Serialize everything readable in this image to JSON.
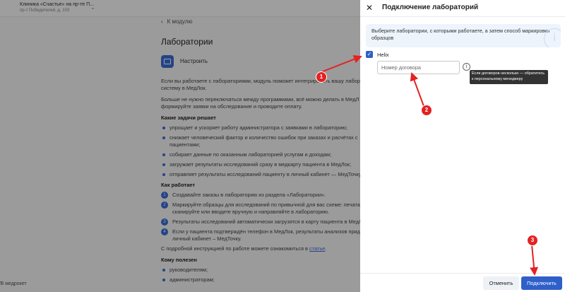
{
  "background": {
    "clinic_name": "Клиника «Счастье» на пр-те П...",
    "clinic_address": "пр-т Победителей, д. 103",
    "back_link": "К модулю",
    "page_title": "Лаборатории",
    "setup_label": "Настроить",
    "intro_1": "Если вы работаете с лабораториями, модуль поможет интегрировать вашу лабор систему в МедЛок.",
    "intro_2": "Больше не нужно переключаться между программами, всё можно делать в МедЛ формируйте заявки на обследование и проводите оплату.",
    "tasks_heading": "Какие задачи решает",
    "tasks": [
      "упрощает и ускоряет работу администратора с заявками в лабораторию;",
      "снижает человеческий фактор и количество ошибок при заказах и расчётах с пациентами;",
      "собирает данные по оказанным лабораторией услугам и доходам;",
      "загружает результаты исследований сразу в медкарту пациента в МедЛок;",
      "отправляет результаты исследований пациенту в личный кабинет — МедТочку."
    ],
    "how_heading": "Как работает",
    "steps": [
      "Создавайте заказы в лабораторию из раздела «Лаборатории».",
      "Маркируйте образцы для исследований по привычной для вас схеме: печата сканируйте или вводите вручную и направляйте в лабораторию.",
      "Результаты исследований автоматически загрузятся в карту пациента в МедЛ",
      "Если у пациента подтверждён телефон в МедЛок, результаты анализов прид в личный кабинет – МедТочку."
    ],
    "instruction_text": "С подробной инструкцией по работе можете ознакомиться в",
    "instruction_link": "статье",
    "useful_heading": "Кому полезен",
    "useful": [
      "руководителям;",
      "администраторам;"
    ],
    "footer_logo": "медрокет"
  },
  "panel": {
    "title": "Подключение лабораторий",
    "info_text": "Выберите лаборатории, с которыми работаете, а затем способ маркировки образцов",
    "lab_name": "Helix",
    "lab_checked": true,
    "contract_placeholder": "Номер договора",
    "tooltip": "Если договоров несколько — обратитесь к персональному менеджеру",
    "cancel_label": "Отменить",
    "connect_label": "Подключить"
  },
  "annotations": {
    "badges": [
      "1",
      "2",
      "3"
    ],
    "color": "#e32222"
  },
  "colors": {
    "accent": "#2f5fc9",
    "info_bg": "#eef4fc",
    "tooltip_bg": "#333333"
  }
}
